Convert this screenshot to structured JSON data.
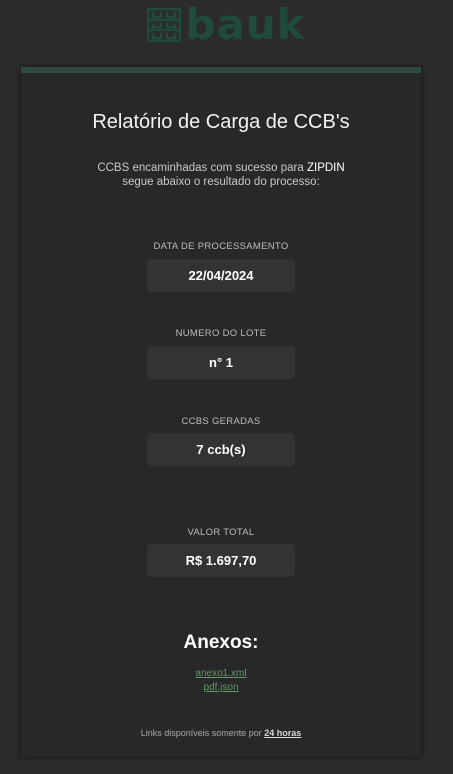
{
  "logo": {
    "text": "bauk",
    "icon": "grid-logo-icon",
    "color": "#1f4a3c"
  },
  "card": {
    "title": "Relatório de Carga de CCB's",
    "message_prefix": "CCBS encaminhadas com sucesso para",
    "company": "ZIPDIN",
    "message_suffix": "segue abaixo o resultado do processo:"
  },
  "fields": [
    {
      "label": "DATA DE PROCESSAMENTO",
      "value": "22/04/2024"
    },
    {
      "label": "NUMERO DO LOTE",
      "value": "n° 1"
    },
    {
      "label": "CCBS GERADAS",
      "value": "7 ccb(s)"
    },
    {
      "label": "VALOR TOTAL",
      "value": "R$ 1.697,70"
    }
  ],
  "attachments": {
    "title": "Anexos:",
    "links": [
      "anexo1.xml",
      "pdf.json"
    ],
    "link_color": "#5e9a6b"
  },
  "footer": {
    "prefix": "Links disponíveis somente por",
    "hours": "24 horas"
  },
  "colors": {
    "accent": "#2f4a41",
    "background": "#2b2b2b",
    "card": "#282828"
  }
}
